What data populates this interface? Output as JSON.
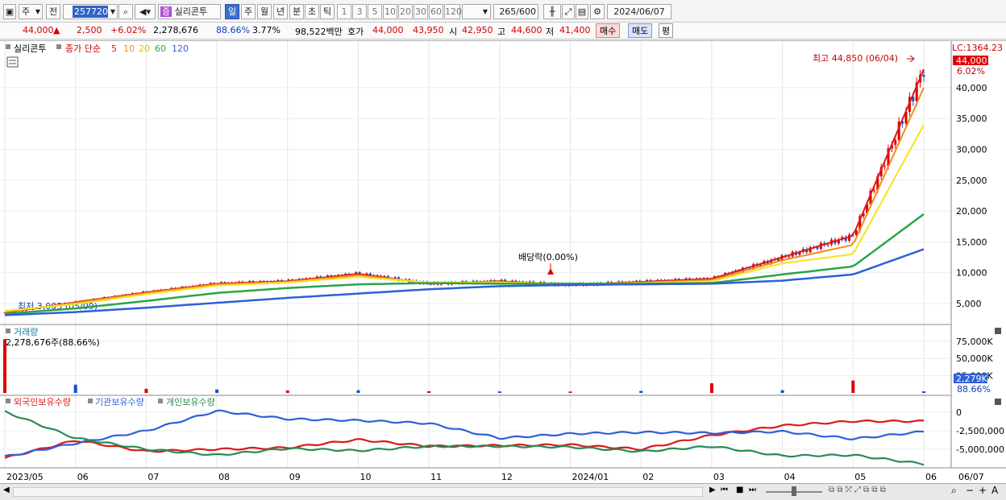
{
  "toolbar": {
    "period_type": "주",
    "prev_label": "전",
    "stock_code": "257720",
    "stock_badge": "증",
    "stock_name": "실리콘투",
    "periods": [
      "일",
      "주",
      "월",
      "년",
      "분",
      "초",
      "틱"
    ],
    "active_period": "일",
    "intervals": [
      "1",
      "3",
      "5",
      "10",
      "20",
      "30",
      "60",
      "120"
    ],
    "count": "265",
    "count_total": "/600",
    "date": "2024/06/07"
  },
  "info": {
    "price": "44,000",
    "up_arrow": "▲",
    "change": "2,500",
    "change_pct": "+6.02%",
    "volume": "2,278,676",
    "volume_ratio": "88.66%",
    "turnover": "3.77%",
    "trade_value": "98,522백만",
    "quote_label": "호가",
    "ask": "44,000",
    "bid": "43,950",
    "open_label": "시",
    "open": "42,950",
    "high_label": "고",
    "high": "44,600",
    "low_label": "저",
    "low": "41,400",
    "buy_label": "매수",
    "sell_label": "매도",
    "eval_label": "평"
  },
  "price_panel": {
    "legend_name": "실리콘투",
    "legend_ma_label": "종가 단순",
    "ma_periods": [
      "5",
      "10",
      "20",
      "60",
      "120"
    ],
    "ma_colors": [
      "#d81b1b",
      "#f08c1e",
      "#f5e41a",
      "#2aa44a",
      "#2f5fd8"
    ],
    "lc_label": "LC:1364.23",
    "current_price_tag": "44,000",
    "change_pct_tag": "6.02%",
    "max_label": "최고 44,850 (06/04)",
    "min_label": "최저 3,005 (05/09)",
    "dividend_label": "배당락(0.00%)",
    "y_ticks": [
      "40,000",
      "35,000",
      "30,000",
      "25,000",
      "20,000",
      "15,000",
      "10,000",
      "5,000"
    ]
  },
  "volume_panel": {
    "title": "거래량",
    "value_label": "2,278,676주(88.66%)",
    "y_ticks": [
      "75,000K",
      "50,000K",
      "25,000K"
    ],
    "current_tag": "2,279K",
    "ratio_tag": "88.66%"
  },
  "holding_panel": {
    "legend": [
      "외국인보유수량",
      "기관보유수량",
      "개인보유수량"
    ],
    "colors": [
      "#d81b1b",
      "#2f5fd8",
      "#2a8a55"
    ],
    "y_ticks": [
      "0",
      "-2,500,000",
      "-5,000,000"
    ]
  },
  "x_axis": {
    "labels": [
      "2023/05",
      "06",
      "07",
      "08",
      "09",
      "10",
      "11",
      "12",
      "2024/01",
      "02",
      "03",
      "04",
      "05",
      "06",
      "06/07"
    ]
  },
  "chart_data": [
    {
      "type": "line",
      "title": "실리콘투",
      "x": [
        "2023/05",
        "06",
        "07",
        "08",
        "09",
        "10",
        "11",
        "12",
        "2024/01",
        "02",
        "03",
        "04",
        "05",
        "06"
      ],
      "series": [
        {
          "name": "5",
          "values": [
            3500,
            5200,
            6800,
            8200,
            8600,
            9800,
            8200,
            8600,
            8000,
            8500,
            9000,
            12500,
            16000,
            43000
          ]
        },
        {
          "name": "10",
          "values": [
            3600,
            5100,
            6700,
            8100,
            8500,
            9600,
            8300,
            8500,
            8100,
            8400,
            8800,
            12000,
            14500,
            40000
          ]
        },
        {
          "name": "20",
          "values": [
            3800,
            4900,
            6500,
            7900,
            8400,
            9300,
            8400,
            8400,
            8200,
            8300,
            8600,
            11500,
            13000,
            34000
          ]
        },
        {
          "name": "60",
          "values": [
            3300,
            4200,
            5400,
            6700,
            7500,
            8100,
            8300,
            8200,
            8200,
            8200,
            8300,
            9700,
            11000,
            19500
          ]
        },
        {
          "name": "120",
          "values": [
            3100,
            3600,
            4300,
            5100,
            5900,
            6600,
            7300,
            7800,
            8000,
            8100,
            8200,
            8700,
            9700,
            13800
          ]
        }
      ],
      "ylim": [
        2500,
        46000
      ]
    },
    {
      "type": "bar",
      "title": "거래량",
      "categories": [
        "2023/05",
        "06",
        "07",
        "08",
        "09",
        "10",
        "11",
        "12",
        "2024/01",
        "02",
        "03",
        "04",
        "05",
        "06"
      ],
      "values": [
        78000,
        12000,
        6000,
        5000,
        3500,
        4000,
        2500,
        2200,
        2000,
        3000,
        14000,
        4000,
        18000,
        2279
      ],
      "ylim": [
        0,
        90000
      ]
    },
    {
      "type": "line",
      "x": [
        "2023/05",
        "06",
        "07",
        "08",
        "09",
        "10",
        "11",
        "12",
        "2024/01",
        "02",
        "03",
        "04",
        "05",
        "06"
      ],
      "series": [
        {
          "name": "외국인보유수량",
          "values": [
            -6200000,
            -3800000,
            -5300000,
            -5000000,
            -4800000,
            -3700000,
            -4600000,
            -4500000,
            -4400000,
            -5000000,
            -3100000,
            -1800000,
            -1200000,
            -1200000
          ]
        },
        {
          "name": "기관보유수량",
          "values": [
            -6000000,
            -4200000,
            -2500000,
            200000,
            -900000,
            -1100000,
            -1500000,
            -3500000,
            -2900000,
            -2700000,
            -2800000,
            -2600000,
            -3600000,
            -2600000
          ]
        },
        {
          "name": "개인보유수량",
          "values": [
            100000,
            -3500000,
            -5000000,
            -5800000,
            -4900000,
            -5200000,
            -4600000,
            -4600000,
            -4700000,
            -5300000,
            -4600000,
            -5900000,
            -5800000,
            -7000000
          ]
        }
      ],
      "ylim": [
        -7300000,
        1000000
      ]
    }
  ]
}
